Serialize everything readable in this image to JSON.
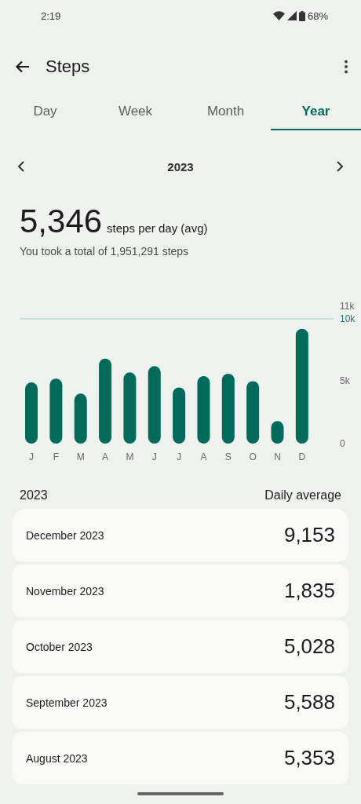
{
  "status_bar": {
    "time": "2:19",
    "battery": "68%"
  },
  "app_bar": {
    "title": "Steps"
  },
  "tabs": [
    {
      "label": "Day",
      "selected": false
    },
    {
      "label": "Week",
      "selected": false
    },
    {
      "label": "Month",
      "selected": false
    },
    {
      "label": "Year",
      "selected": true
    }
  ],
  "period": {
    "label": "2023"
  },
  "summary": {
    "value": "5,346",
    "unit": "steps per day (avg)",
    "total": "You took a total of 1,951,291 steps"
  },
  "chart": {
    "chart_data": {
      "type": "bar",
      "categories": [
        "J",
        "F",
        "M",
        "A",
        "M",
        "J",
        "J",
        "A",
        "S",
        "O",
        "N",
        "D"
      ],
      "values": [
        4900,
        5200,
        4000,
        6800,
        5700,
        6200,
        4500,
        5400,
        5600,
        5000,
        1800,
        9200
      ],
      "ylim": [
        0,
        11000
      ],
      "yticks": [
        {
          "value": 0,
          "label": "0"
        },
        {
          "value": 5000,
          "label": "5k"
        },
        {
          "value": 10000,
          "label": "10k"
        },
        {
          "value": 11000,
          "label": "11k"
        }
      ],
      "ref_lines": [
        {
          "axis": "y",
          "value": 10000
        }
      ]
    }
  },
  "list_header": {
    "period": "2023",
    "metric": "Daily average"
  },
  "months": [
    {
      "label": "December 2023",
      "value": "9,153"
    },
    {
      "label": "November 2023",
      "value": "1,835"
    },
    {
      "label": "October 2023",
      "value": "5,028"
    },
    {
      "label": "September 2023",
      "value": "5,588"
    },
    {
      "label": "August 2023",
      "value": "5,353"
    }
  ]
}
